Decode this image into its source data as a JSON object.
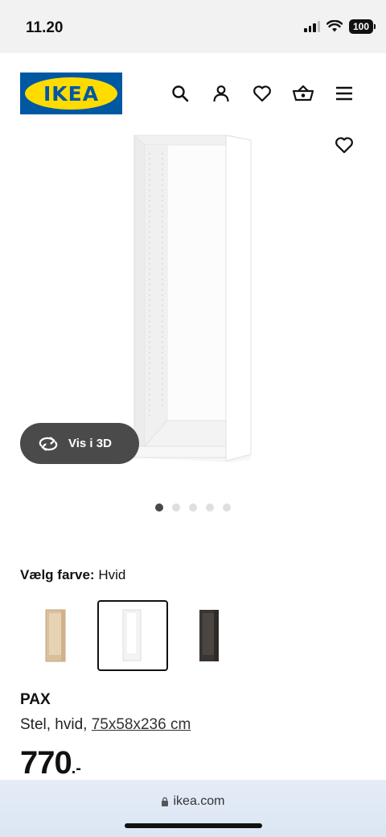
{
  "status_bar": {
    "time": "11.20",
    "battery": "100"
  },
  "header": {
    "logo_text": "IKEA",
    "icons": [
      "search-icon",
      "user-icon",
      "heart-icon",
      "basket-icon",
      "menu-icon"
    ]
  },
  "product_image": {
    "view_3d_label": "Vis i 3D",
    "carousel": {
      "total": 5,
      "active": 1
    }
  },
  "color_selector": {
    "label": "Vælg farve:",
    "selected_value": "Hvid",
    "options": [
      {
        "name": "oak",
        "color": "#d9bf9a"
      },
      {
        "name": "white",
        "color": "#ffffff"
      },
      {
        "name": "dark",
        "color": "#3a3532"
      }
    ]
  },
  "product": {
    "name": "PAX",
    "description_prefix": "Stel, hvid, ",
    "dimensions_link": "75x58x236 cm",
    "price_integer": "770",
    "price_suffix": ".-"
  },
  "browser": {
    "url": "ikea.com"
  },
  "colors": {
    "ikea_blue": "#0058a3",
    "ikea_yellow": "#ffdb00",
    "pill_bg": "#4a4a4a"
  }
}
